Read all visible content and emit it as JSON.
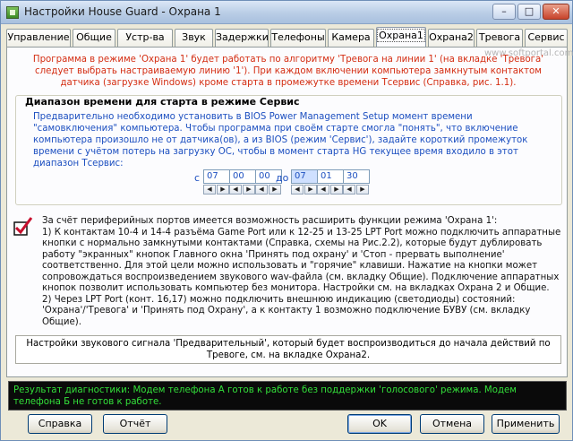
{
  "window": {
    "title": "Настройки House Guard - Охрана 1",
    "controls": {
      "minimize": "–",
      "maximize": "□",
      "close": "✕"
    },
    "watermark": "PORTAL",
    "watermark_url": "www.softportal.com"
  },
  "tabs": [
    {
      "label": "Управление"
    },
    {
      "label": "Общие"
    },
    {
      "label": "Устр-ва"
    },
    {
      "label": "Звук"
    },
    {
      "label": "Задержки"
    },
    {
      "label": "Телефоны"
    },
    {
      "label": "Камера"
    },
    {
      "label": "Охрана1"
    },
    {
      "label": "Охрана2"
    },
    {
      "label": "Тревога"
    },
    {
      "label": "Сервис"
    }
  ],
  "active_tab": "Охрана1",
  "intro_red": "Программа в режиме 'Охрана 1' будет работать по алгоритму 'Тревога на линии 1' (на вкладке 'Тревога' следует выбрать настраиваемую линию '1'). При каждом включении компьютера замкнутым контактом датчика (загрузке Windows) кроме старта в промежутке времени Тсервис (Справка, рис. 1.1).",
  "range_group": {
    "title": "Диапазон времени для старта в режиме Сервис",
    "description": "Предварительно необходимо установить в BIOS Power Management Setup момент времени \"самовключения\" компьютера. Чтобы программа при своём старте смогла \"понять\", что включение компьютера произошло не от датчика(ов), а из BIOS (режим 'Сервис'), задайте короткий промежуток времени с учётом потерь на загрузку ОС, чтобы в момент старта HG текущее время входило в этот диапазон Тсервис:",
    "from_label": "с",
    "to_label": "до",
    "from": [
      "07",
      "00",
      "00"
    ],
    "to": [
      "07",
      "01",
      "30"
    ],
    "spin_left": "◀",
    "spin_right": "▶"
  },
  "ports_text": "За счёт периферийных портов имеется возможность расширить функции режима 'Охрана 1':\n1) К контактам 10-4 и 14-4 разъёма Game Port или к 12-25 и 13-25 LPT Port можно подключить аппаратные кнопки с нормально замкнутыми контактами (Справка, схемы на Рис.2.2), которые будут дублировать работу \"экранных\" кнопок Главного окна 'Принять под охрану' и 'Стоп - прервать выполнение' соответственно. Для этой цели можно использовать и \"горячие\" клавиши. Нажатие на кнопки может сопровождаться воспроизведением звукового wav-файла (см. вкладку Общие). Подключение аппаратных кнопок позволит использовать компьютер без монитора. Настройки см. на вкладках Охрана 2 и Общие.\n2) Через LPT Port (конт. 16,17) можно подключить внешнюю индикацию (светодиоды) состояний: 'Охрана'/'Тревога' и 'Принять под Охрану', а к контакту 1 возможно подключение БУВУ (см. вкладку Общие).",
  "sound_info": "Настройки звукового сигнала 'Предварительный', который будет воспроизводиться до начала действий по Тревоге, см. на вкладке Охрана2.",
  "status": "Результат диагностики: Модем телефона А готов к работе без поддержки 'голосового' режима. Модем телефона Б не готов к работе.",
  "buttons": {
    "help": "Справка",
    "report": "Отчёт",
    "ok": "OK",
    "cancel": "Отмена",
    "apply": "Применить"
  },
  "colors": {
    "intro_text": "#d42d12",
    "blue_text": "#1c4fc0",
    "status_text": "#33e03a",
    "status_bg": "#0a0a0a"
  }
}
